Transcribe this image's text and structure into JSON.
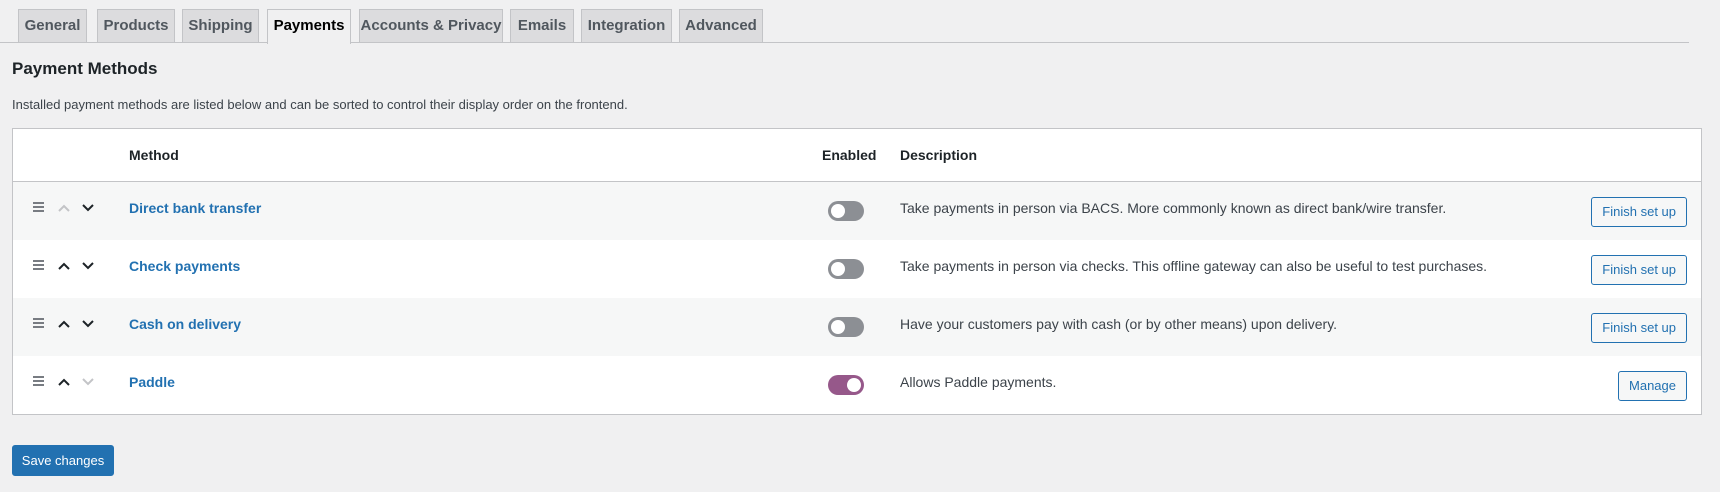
{
  "tabs": [
    {
      "label": "General",
      "active": false
    },
    {
      "label": "Products",
      "active": false
    },
    {
      "label": "Shipping",
      "active": false
    },
    {
      "label": "Payments",
      "active": true
    },
    {
      "label": "Accounts & Privacy",
      "active": false
    },
    {
      "label": "Emails",
      "active": false
    },
    {
      "label": "Integration",
      "active": false
    },
    {
      "label": "Advanced",
      "active": false
    }
  ],
  "page": {
    "title": "Payment Methods",
    "intro": "Installed payment methods are listed below and can be sorted to control their display order on the frontend."
  },
  "table": {
    "headers": {
      "method": "Method",
      "enabled": "Enabled",
      "description": "Description"
    },
    "rows": [
      {
        "name": "Direct bank transfer",
        "enabled": false,
        "description": "Take payments in person via BACS. More commonly known as direct bank/wire transfer.",
        "action": "Finish set up",
        "can_move_up": false,
        "can_move_down": true
      },
      {
        "name": "Check payments",
        "enabled": false,
        "description": "Take payments in person via checks. This offline gateway can also be useful to test purchases.",
        "action": "Finish set up",
        "can_move_up": true,
        "can_move_down": true
      },
      {
        "name": "Cash on delivery",
        "enabled": false,
        "description": "Have your customers pay with cash (or by other means) upon delivery.",
        "action": "Finish set up",
        "can_move_up": true,
        "can_move_down": true
      },
      {
        "name": "Paddle",
        "enabled": true,
        "description": "Allows Paddle payments.",
        "action": "Manage",
        "can_move_up": true,
        "can_move_down": false
      }
    ]
  },
  "footer": {
    "save_label": "Save changes"
  },
  "colors": {
    "link": "#2271b1",
    "toggle_on": "#96588a",
    "toggle_off": "#8c8f94",
    "arrow_active": "#1d2327",
    "arrow_disabled": "#c3c4c7"
  },
  "icons": {
    "drag": "drag-handle-icon",
    "up": "chevron-up-icon",
    "down": "chevron-down-icon"
  }
}
